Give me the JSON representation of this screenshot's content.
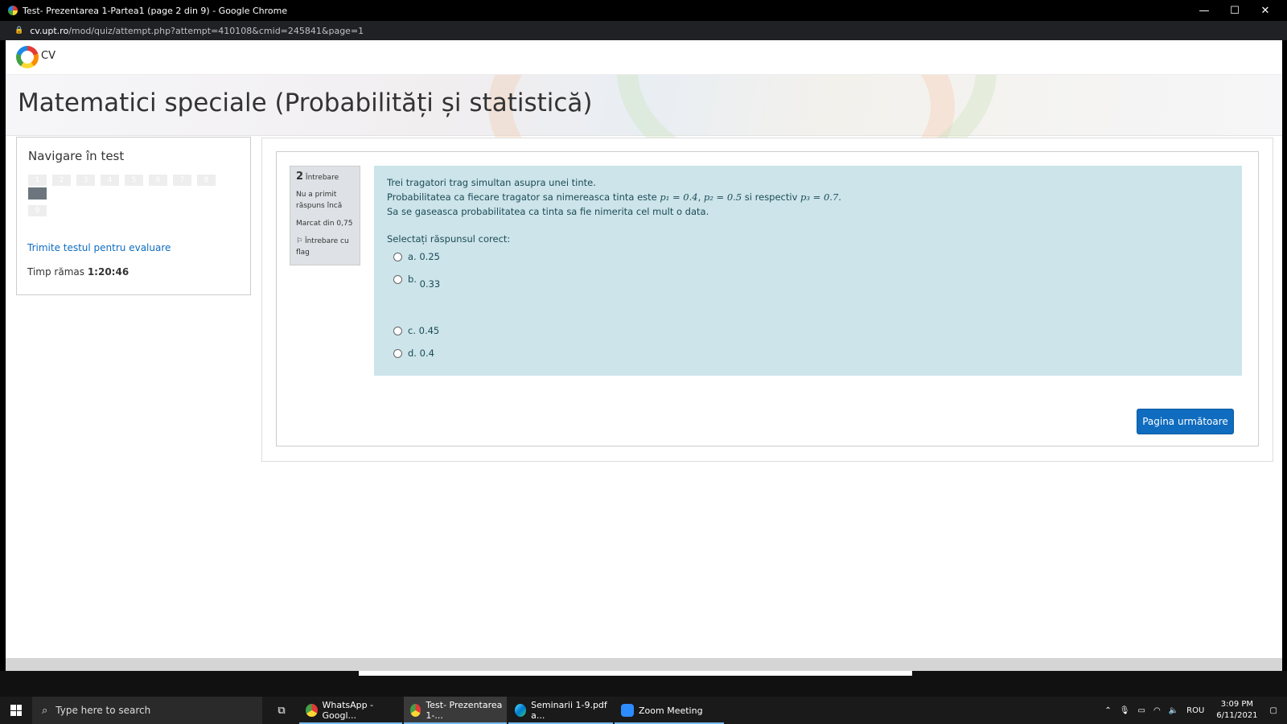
{
  "window": {
    "title": "Test- Prezentarea 1-Partea1 (page 2 din 9) - Google Chrome",
    "minimize_icon": "minimize-icon",
    "maximize_icon": "maximize-icon",
    "close_icon": "close-icon"
  },
  "address": {
    "host": "cv.upt.ro",
    "path": "/mod/quiz/attempt.php?attempt=410108&cmid=245841&page=1"
  },
  "site": {
    "logo_text": "CV"
  },
  "page_title": "Matematici speciale (Probabilități și statistică)",
  "quiz_nav": {
    "heading": "Navigare în test",
    "questions": [
      "1",
      "2",
      "3",
      "4",
      "5",
      "6",
      "7",
      "8",
      "9"
    ],
    "current": 2,
    "submit_link": "Trimite testul pentru evaluare",
    "timer_label": "Timp rămas",
    "timer_value": "1:20:46"
  },
  "question": {
    "number": "2",
    "number_label": "Întrebare",
    "state": "Nu a primit răspuns încă",
    "grade": "Marcat din 0,75",
    "flag_label": "Întrebare cu flag",
    "text_line1": "Trei tragatori trag simultan asupra unei tinte.",
    "text_line2_prefix": "Probabilitatea ca fiecare tragator sa nimereasca tinta este ",
    "p1": "p₁ = 0.4",
    "p2": "p₂ = 0.5",
    "text_line2_mid": " si respectiv ",
    "p3": "p₃ = 0.7",
    "text_line3": "Sa se gaseasca probabilitatea ca tinta sa fie nimerita cel mult o data.",
    "prompt": "Selectați răspunsul corect:",
    "answers": [
      {
        "letter": "a.",
        "value": "0.25"
      },
      {
        "letter": "b.",
        "value": "0.33"
      },
      {
        "letter": "c.",
        "value": "0.45"
      },
      {
        "letter": "d.",
        "value": "0.4"
      }
    ]
  },
  "next_button": "Pagina următoare",
  "taskbar": {
    "search_placeholder": "Type here to search",
    "apps": [
      {
        "label": "WhatsApp - Googl...",
        "color": "#4caf50"
      },
      {
        "label": "Test- Prezentarea 1-...",
        "color": "#e53935"
      },
      {
        "label": "Seminarii 1-9.pdf a...",
        "color": "#0078d4"
      },
      {
        "label": "Zoom Meeting",
        "color": "#2d8cff"
      }
    ],
    "language": "ROU",
    "time": "3:09 PM",
    "date": "6/11/2021"
  }
}
